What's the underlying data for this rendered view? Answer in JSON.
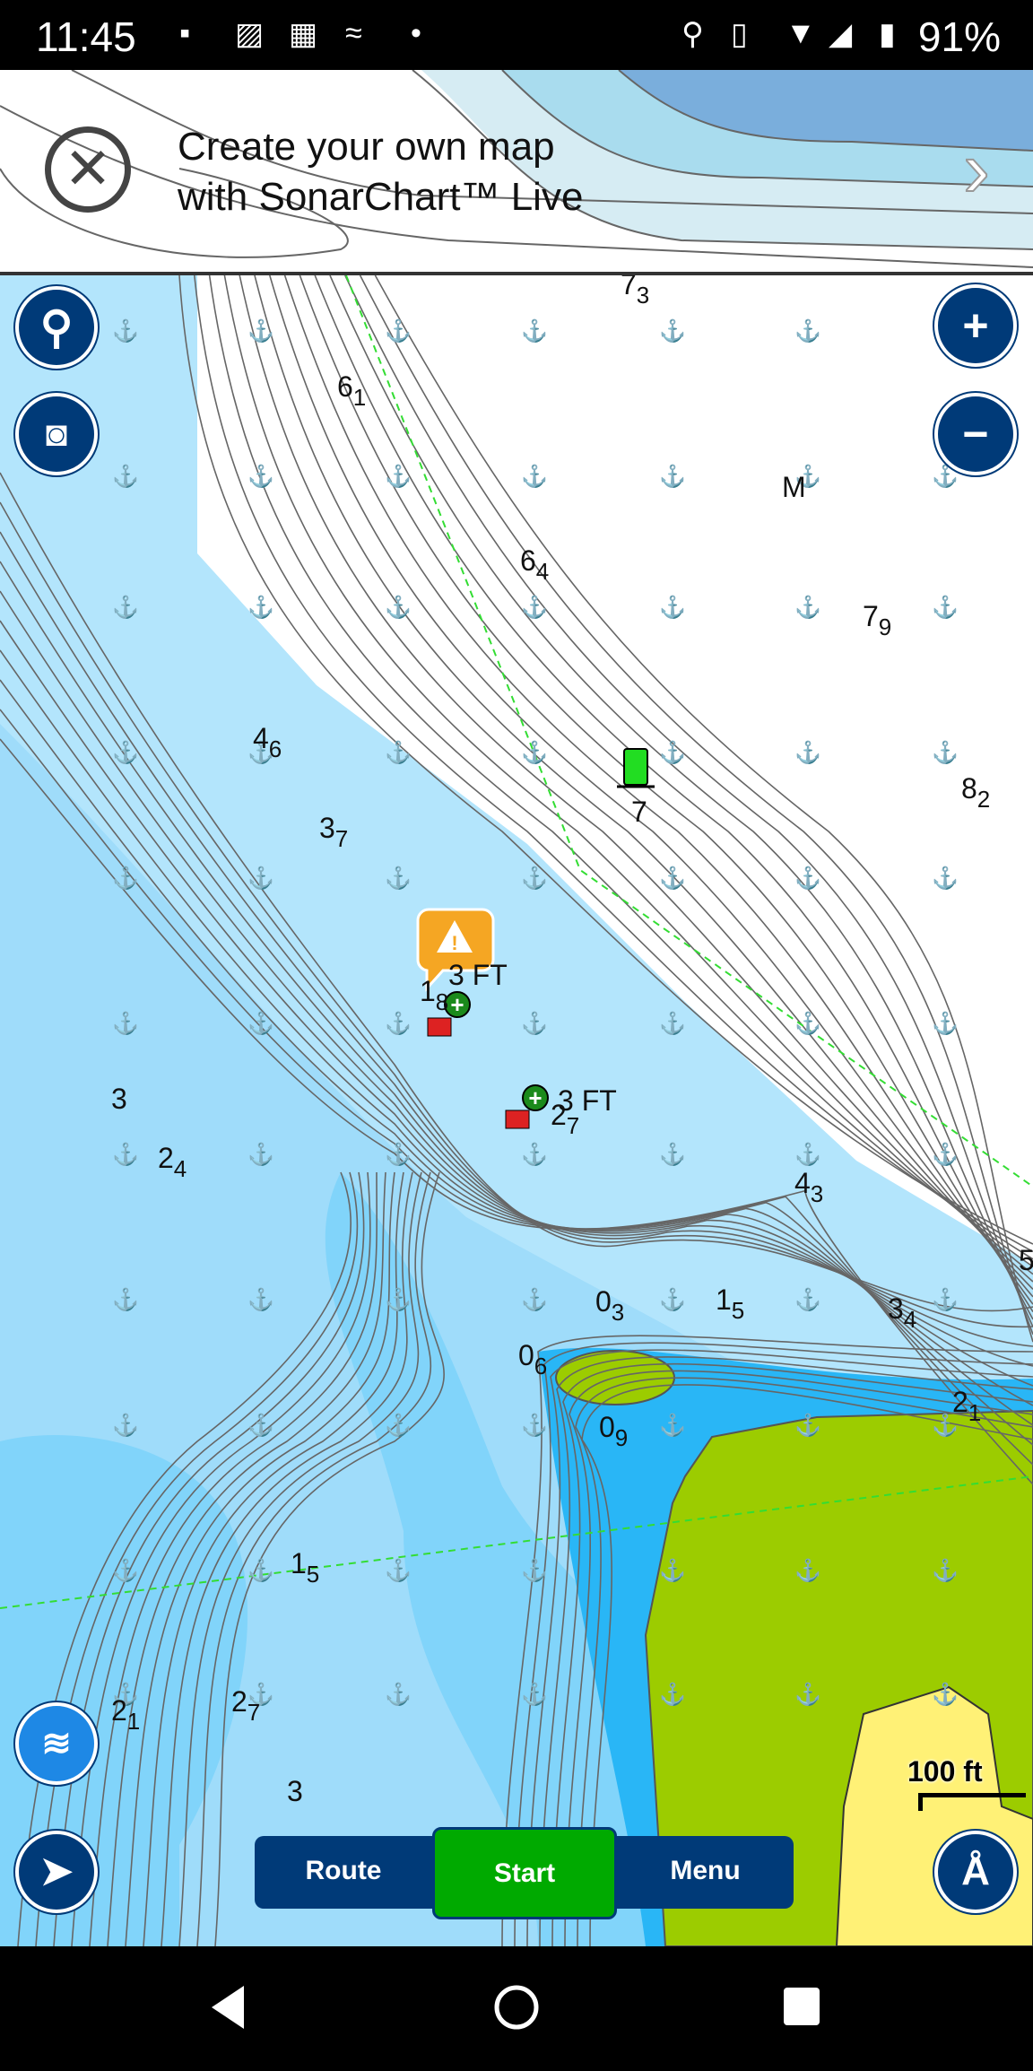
{
  "status_bar": {
    "time": "11:45",
    "battery": "91%",
    "icons": [
      "image-icon",
      "chart-message-icon",
      "calendar-31-icon",
      "nfc-icon",
      "dot-icon",
      "location-icon",
      "vibrate-icon",
      "wifi-icon",
      "signal-icon",
      "battery-icon"
    ]
  },
  "banner": {
    "line1": "Create your own map",
    "line2": "with SonarChart™ Live"
  },
  "map": {
    "colors": {
      "deep": "#29b6f6",
      "shallow": "#b3e5fc",
      "mid": "#81d4fa",
      "land": "#9ccc00",
      "beach": "#fff176",
      "magenta": "#ff00ff"
    },
    "depths": [
      {
        "v": "7",
        "s": "3"
      },
      {
        "v": "6",
        "s": "1"
      },
      {
        "v": "6",
        "s": "4"
      },
      {
        "v": "M",
        "s": ""
      },
      {
        "v": "7",
        "s": "9"
      },
      {
        "v": "4",
        "s": "6"
      },
      {
        "v": "8",
        "s": "2"
      },
      {
        "v": "3",
        "s": "7"
      },
      {
        "v": "7",
        "s": ""
      },
      {
        "v": "1",
        "s": "8"
      },
      {
        "v": "3",
        "s": ""
      },
      {
        "v": "2",
        "s": "7"
      },
      {
        "v": "2",
        "s": "4"
      },
      {
        "v": "4",
        "s": "3"
      },
      {
        "v": "5",
        "s": ""
      },
      {
        "v": "0",
        "s": "3"
      },
      {
        "v": "1",
        "s": "5"
      },
      {
        "v": "3",
        "s": "4"
      },
      {
        "v": "0",
        "s": "6"
      },
      {
        "v": "2",
        "s": "1"
      },
      {
        "v": "0",
        "s": "9"
      },
      {
        "v": "1",
        "s": "5"
      },
      {
        "v": "2",
        "s": "1"
      },
      {
        "v": "2",
        "s": "7"
      },
      {
        "v": "3",
        "s": ""
      }
    ],
    "hazard_labels": [
      "3 FT",
      "3 FT"
    ],
    "scale": "100 ft"
  },
  "buttons": {
    "route": "Route",
    "start": "Start",
    "menu": "Menu",
    "zoom_in": "+",
    "zoom_out": "−"
  }
}
